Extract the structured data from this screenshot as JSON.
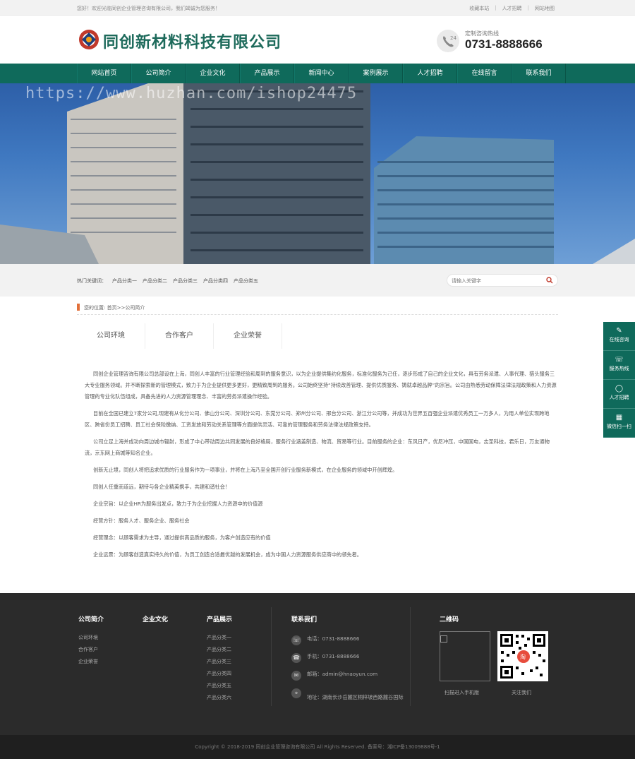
{
  "topbar": {
    "welcome": "您好！欢迎光临同创企业管理咨询有限公司，我们竭诚为您服务！",
    "links": [
      "收藏本站",
      "人才招聘",
      "网站地图"
    ]
  },
  "header": {
    "company_name": "同创新材料科技有限公司",
    "hotline_label": "定制咨询热线",
    "hotline_number": "0731-8888666"
  },
  "nav": {
    "items": [
      "网站首页",
      "公司简介",
      "企业文化",
      "产品展示",
      "新闻中心",
      "案例展示",
      "人才招聘",
      "在线留言",
      "联系我们"
    ]
  },
  "banner": {
    "watermark": "https://www.huzhan.com/ishop24475"
  },
  "search": {
    "hot_label": "热门关键词：",
    "hot_keywords": [
      "产品分类一",
      "产品分类二",
      "产品分类三",
      "产品分类四",
      "产品分类五"
    ],
    "placeholder": "请输入关键字"
  },
  "breadcrumb": {
    "text": "您的位置: 首页>>公司简介"
  },
  "tabs": [
    "公司环境",
    "合作客户",
    "企业荣誉"
  ],
  "content": {
    "paragraphs": [
      "同创企业管理咨询有限公司总部设在上海，同创人丰富的行业管理经验和周到的服务意识，以为企业提供集约化服务，标准化服务为己任，逐步形成了自己的企业文化，具有劳务派遣、人事代理、猎头服务三大专业服务领域。并不断探索新的管理模式，致力于为企业提供更多更好，更精致周到的服务。公司始终坚持“持续改善管理、提供优质服务、铸就卓越品牌”的宗旨。公司由熟悉劳动保障法律法规政策和人力资源管理的专业化队伍组成，具备先进的人力资源管理理念、丰富的劳务派遣操作经验。",
      "目前在全国已建立7家分公司,现建有从化分公司、佛山分公司、深圳分公司、东莞分公司、郑州分公司、邢台分公司、浙江分公司等，并成功为世界五百强企业派遣优秀员工一万多人，为用人单位实现跨地区、跨省份员工招聘、员工社会保险缴纳、工资发放和劳动关系管理等方面提供灵活、可靠的管理服务和劳务法律法规政策支持。",
      "公司立足上海并成功向周边城市辐射，形成了中心带动周边共同发展的良好格局，服务行业涵盖制造、物流、贸易等行业。目前服务的企业：东风日产，优尼冲压，中国国电，志圣科技，君乐日，万友通物流，京东网上商城等知名企业。",
      "创新无止境，同创人将把追求优质的行业服务作为一项事业，并将在上海乃至全国开创行业服务新模式，在企业服务的领域中开创辉煌。",
      "同创人任重而道远，期待与各企业精英携手，共建和谐社会！",
      "企业宗旨：以企业HR为服务出发点，致力于为企业挖掘人力资源中的价值源",
      "经营方针：服务人才、服务企业、服务社会",
      "经营理念：以顾客需求为主导，通过提供高品质的服务，为客户创造应有的价值",
      "企业远景：为顾客创造真实持久的价值，为员工创造合适最优越的发展机会，成为中国人力资源服务供应商中的领先者。"
    ]
  },
  "sidetools": [
    {
      "label": "在线咨询",
      "icon": "chat-icon"
    },
    {
      "label": "服务热线",
      "icon": "phone-icon"
    },
    {
      "label": "人才招聘",
      "icon": "message-icon"
    },
    {
      "label": "微信扫一扫",
      "icon": "qrcode-icon"
    }
  ],
  "footer": {
    "about": {
      "title": "公司简介",
      "links": [
        "公司环境",
        "合作客户",
        "企业荣誉"
      ]
    },
    "culture": {
      "title": "企业文化"
    },
    "products": {
      "title": "产品展示",
      "links": [
        "产品分类一",
        "产品分类二",
        "产品分类三",
        "产品分类四",
        "产品分类五",
        "产品分类六"
      ]
    },
    "contact": {
      "title": "联系我们",
      "phone": "电话：0731-8888666",
      "mobile": "手机：0731-8888666",
      "email": "邮箱：admin@hnaoyun.com",
      "address": "地址：湖南长沙岳麓区桐梓坡西路麓谷国际"
    },
    "qrcode": {
      "title": "二维码",
      "caption1": "扫描进入手机版",
      "caption2": "关注我们"
    }
  },
  "copyright": "Copyright © 2018-2019 同创企业管理咨询有限公司 All Rights Reserved.    备案号：湘ICP备13009888号-1",
  "colors": {
    "brand": "#0f6a5b",
    "accent": "#e2703a",
    "footer_bg": "#2b2b2b"
  }
}
